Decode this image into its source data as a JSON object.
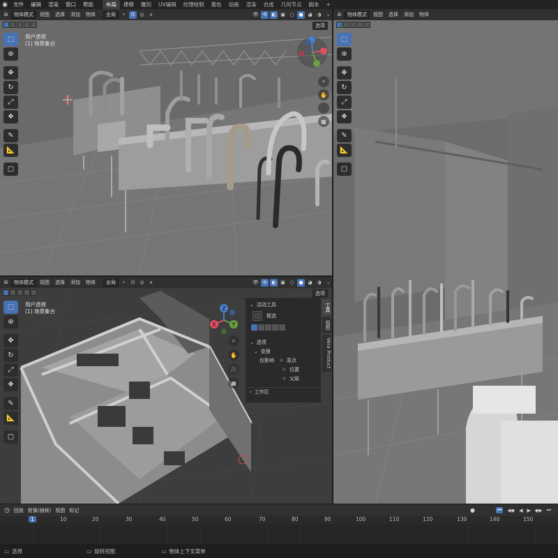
{
  "menubar": {
    "items": [
      "文件",
      "编辑",
      "渲染",
      "窗口",
      "帮助"
    ],
    "workspaces": [
      "布局",
      "建模",
      "雕刻",
      "UV编辑",
      "纹理绘制",
      "着色",
      "动画",
      "渲染",
      "合成",
      "几何节点",
      "脚本"
    ],
    "active_workspace": "布局",
    "add_tab": "+"
  },
  "viewport_tl": {
    "mode": "物体模式",
    "menus": [
      "视图",
      "选择",
      "添加",
      "物体"
    ],
    "transform": "全局",
    "options": "选项",
    "view_name": "用户透视",
    "collection": "(1) 场景集合"
  },
  "viewport_bl": {
    "mode": "物体模式",
    "menus": [
      "视图",
      "选择",
      "添加",
      "物体"
    ],
    "transform": "全局",
    "options": "选项",
    "view_name": "用户透视",
    "collection": "(1) 场景集合"
  },
  "viewport_right": {
    "mode": "物体模式",
    "menus": [
      "视图",
      "选择",
      "添加",
      "物体"
    ]
  },
  "npanel": {
    "active_tool_title": "活动工具",
    "tool_name": "框选",
    "options_title": "选项",
    "transform_title": "变换",
    "affect_only_label": "仅影响",
    "origins": "原点",
    "locations": "位置",
    "parents": "父级",
    "workspace_title": "工作区",
    "tabs": [
      "工具",
      "视图",
      "Vera Product"
    ]
  },
  "gizmo": {
    "x": "X",
    "y": "Y",
    "z": "Z"
  },
  "timeline": {
    "playback": "回放",
    "keying": "抠像(插帧)",
    "view": "视图",
    "marker": "标记",
    "current_frame": "1",
    "ticks": [
      "1",
      "10",
      "20",
      "30",
      "40",
      "50",
      "60",
      "70",
      "80",
      "90",
      "100",
      "110",
      "120",
      "130",
      "140",
      "150"
    ]
  },
  "statusbar": {
    "select": "选择",
    "rotate_view": "旋转视图",
    "context_menu": "物体上下文菜单"
  },
  "colors": {
    "accent": "#4772b3",
    "header": "#303030",
    "panel": "#2a2a2a",
    "frame_marker": "#4772b3"
  }
}
